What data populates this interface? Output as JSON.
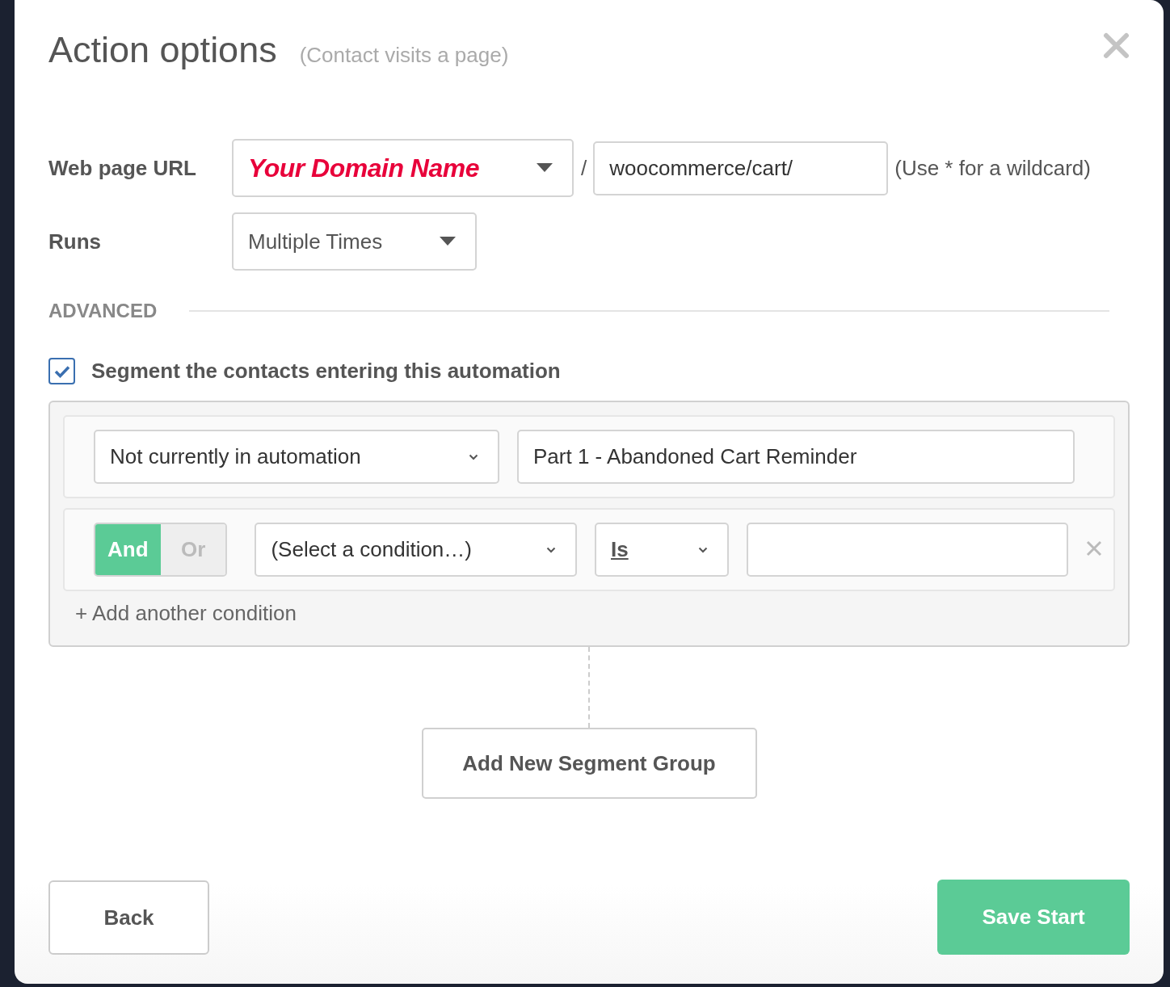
{
  "dialog": {
    "title": "Action options",
    "subtitle": "(Contact visits a page)"
  },
  "url_row": {
    "label": "Web page URL",
    "domain": "Your Domain Name",
    "separator": "/",
    "path": "woocommerce/cart/",
    "hint": "(Use * for a wildcard)"
  },
  "runs": {
    "label": "Runs",
    "value": "Multiple Times"
  },
  "advanced": {
    "heading": "ADVANCED"
  },
  "segment": {
    "checked": true,
    "label": "Segment the contacts entering this automation",
    "conditions": [
      {
        "kind": "first",
        "field": "Not currently in automation",
        "value": "Part 1 - Abandoned Cart Reminder"
      },
      {
        "kind": "joined",
        "logic": [
          {
            "label": "And",
            "selected": true
          },
          {
            "label": "Or",
            "selected": false
          }
        ],
        "field": "(Select a condition…)",
        "operator": "Is"
      }
    ],
    "add_condition": "+ Add another condition"
  },
  "add_group": "Add New Segment Group",
  "buttons": {
    "back": "Back",
    "save": "Save Start"
  }
}
